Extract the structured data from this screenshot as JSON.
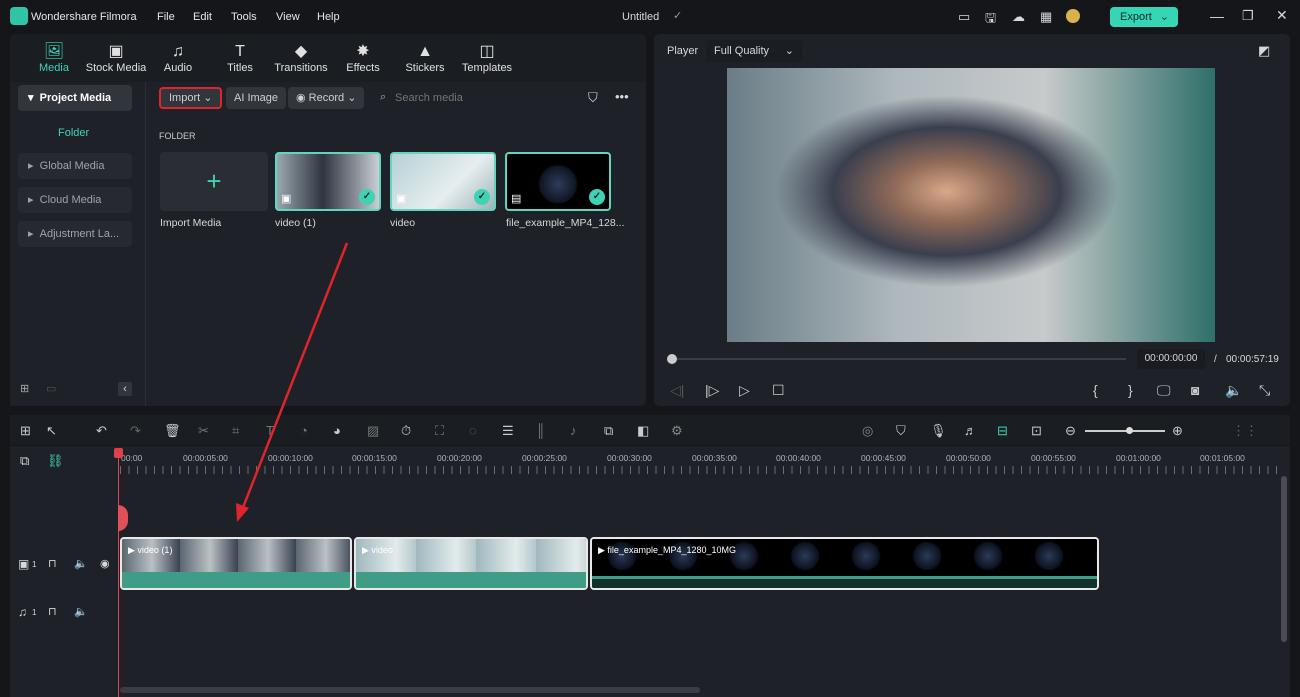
{
  "app": {
    "title": "Wondershare Filmora",
    "project": "Untitled",
    "menu": [
      "File",
      "Edit",
      "Tools",
      "View",
      "Help"
    ],
    "export_label": "Export",
    "accent": "#3fd3b5"
  },
  "media_tabs": [
    {
      "label": "Media",
      "icon": "media-icon",
      "active": true
    },
    {
      "label": "Stock Media",
      "icon": "stock-media-icon"
    },
    {
      "label": "Audio",
      "icon": "music-note-icon"
    },
    {
      "label": "Titles",
      "icon": "title-t-icon"
    },
    {
      "label": "Transitions",
      "icon": "transitions-icon"
    },
    {
      "label": "Effects",
      "icon": "effects-sparkle-icon"
    },
    {
      "label": "Stickers",
      "icon": "stickers-icon"
    },
    {
      "label": "Templates",
      "icon": "templates-icon"
    }
  ],
  "sidebar": {
    "items": [
      {
        "label": "Project Media",
        "active": true
      },
      {
        "label": "Folder"
      },
      {
        "label": "Global Media"
      },
      {
        "label": "Cloud Media"
      },
      {
        "label": "Adjustment La..."
      }
    ]
  },
  "media_toolbar": {
    "import": "Import",
    "ai_image": "AI Image",
    "record": "Record",
    "search_placeholder": "Search media"
  },
  "folder_label": "FOLDER",
  "media_items": [
    {
      "label": "Import Media"
    },
    {
      "label": "video (1)"
    },
    {
      "label": "video"
    },
    {
      "label": "file_example_MP4_128..."
    }
  ],
  "player": {
    "label": "Player",
    "quality": "Full Quality",
    "current_time": "00:00:00:00",
    "separator": "/",
    "total_time": "00:00:57:19",
    "progress": 0
  },
  "timeline": {
    "ruler": [
      "00:00",
      "00:00:05:00",
      "00:00:10:00",
      "00:00:15:00",
      "00:00:20:00",
      "00:00:25:00",
      "00:00:30:00",
      "00:00:35:00",
      "00:00:40:00",
      "00:00:45:00",
      "00:00:50:00",
      "00:00:55:00",
      "00:01:00:00",
      "00:01:05:00"
    ],
    "video_track_num": "1",
    "audio_track_num": "1",
    "clips": [
      {
        "name": "video (1)"
      },
      {
        "name": "video"
      },
      {
        "name": "file_example_MP4_1280_10MG"
      }
    ]
  }
}
